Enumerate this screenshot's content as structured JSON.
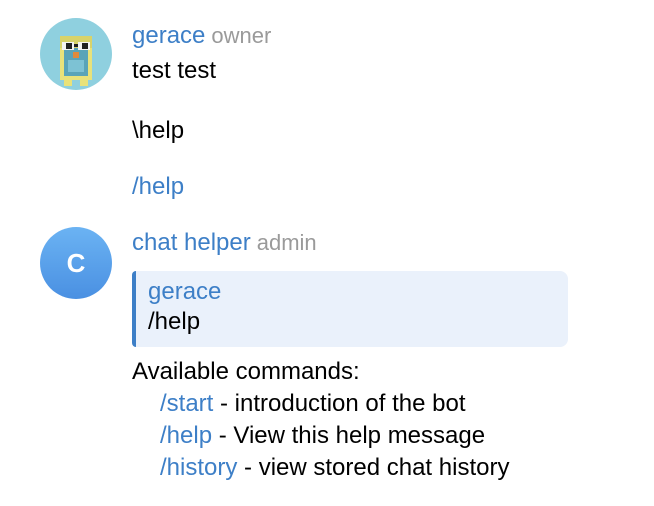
{
  "messages": [
    {
      "sender": "gerace",
      "role": "owner",
      "avatar_icon": "owl-avatar-icon",
      "lines": [
        "test test",
        "\\help",
        "/help"
      ]
    },
    {
      "sender": "chat helper",
      "role": "admin",
      "avatar_letter": "C",
      "reply_to": {
        "sender": "gerace",
        "text": "/help"
      },
      "intro": "Available commands:",
      "commands": [
        {
          "command": "/start",
          "description": " - introduction of the bot"
        },
        {
          "command": "/help",
          "description": " - View this help message"
        },
        {
          "command": "/history",
          "description": " - view stored chat history"
        }
      ]
    }
  ],
  "colors": {
    "link": "#3d7fc7",
    "role": "#9a9a9a",
    "quote_bg": "#eaf1fb",
    "avatar_bg": "#8fd0df"
  }
}
